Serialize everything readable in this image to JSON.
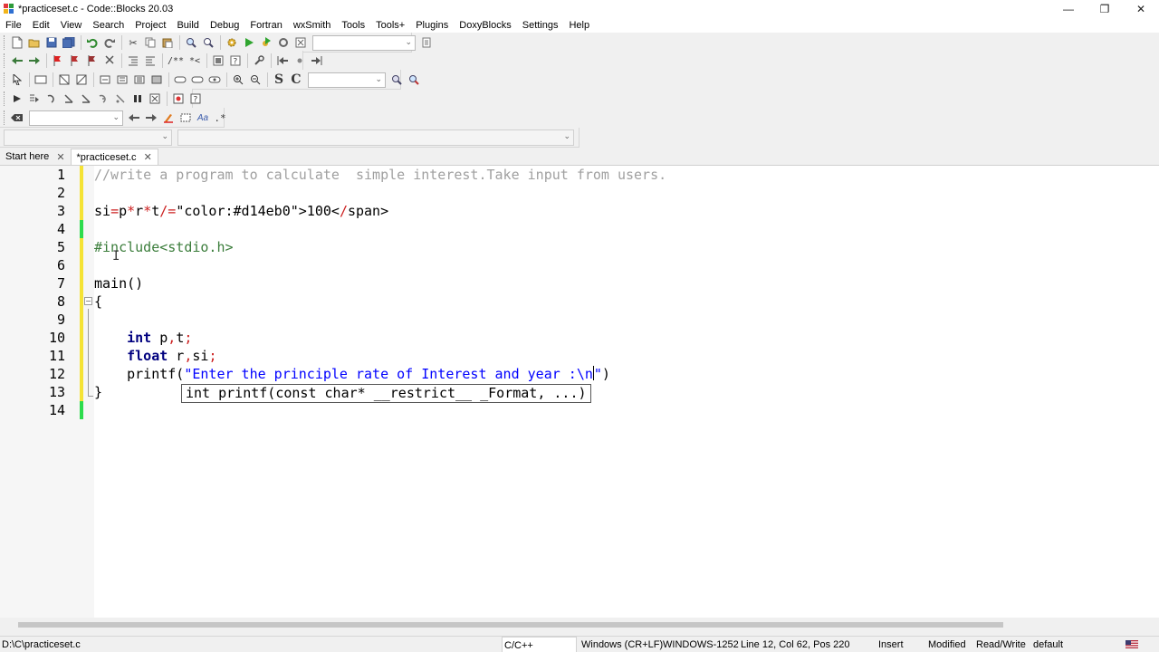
{
  "window": {
    "title": "*practiceset.c - Code::Blocks 20.03",
    "minimize": "—",
    "restore": "❐",
    "close": "✕"
  },
  "menu": [
    "File",
    "Edit",
    "View",
    "Search",
    "Project",
    "Build",
    "Debug",
    "Fortran",
    "wxSmith",
    "Tools",
    "Tools+",
    "Plugins",
    "DoxyBlocks",
    "Settings",
    "Help"
  ],
  "toolbar": {
    "comment_btn": "/**",
    "uncomment_btn": "*<",
    "search_s": "S",
    "search_c": "C",
    "regex_btn": ".*"
  },
  "tabs": [
    {
      "label": "Start here",
      "close": "✕"
    },
    {
      "label": "*practiceset.c",
      "close": "✕"
    }
  ],
  "editor": {
    "lines": [
      {
        "num": "1",
        "text": "//write a program to calculate  simple interest.Take input from users."
      },
      {
        "num": "2",
        "text": ""
      },
      {
        "num": "3",
        "text": "si=p*r*t/100"
      },
      {
        "num": "4",
        "text": ""
      },
      {
        "num": "5",
        "text": "#include<stdio.h>"
      },
      {
        "num": "6",
        "text": ""
      },
      {
        "num": "7",
        "text": "main()"
      },
      {
        "num": "8",
        "text": "{"
      },
      {
        "num": "9",
        "text": ""
      },
      {
        "num": "10",
        "text": "    int p,t;"
      },
      {
        "num": "11",
        "text": "    float r,si;"
      },
      {
        "num": "12",
        "text": "    printf(\"Enter the principle rate of Interest and year :\\n\")"
      },
      {
        "num": "13",
        "text": "}"
      },
      {
        "num": "14",
        "text": ""
      }
    ],
    "calltip": "int printf(const char* __restrict__ _Format, ...)",
    "colors": {
      "comment": "#a0a0a0",
      "keyword": "#00007f",
      "number": "#d14eb0",
      "string": "#0000ff",
      "preproc": "#3b7d3b",
      "operator": "#cc2020",
      "changed_saved": "#2ddc4d",
      "changed_unsaved": "#f5e335"
    }
  },
  "status": {
    "path": "D:\\C\\practiceset.c",
    "language": "C/C++",
    "line_endings": "Windows (CR+LF)",
    "encoding": "WINDOWS-1252",
    "position": "Line 12, Col 62, Pos 220",
    "mode": "Insert",
    "modified": "Modified",
    "access": "Read/Write",
    "profile": "default"
  }
}
